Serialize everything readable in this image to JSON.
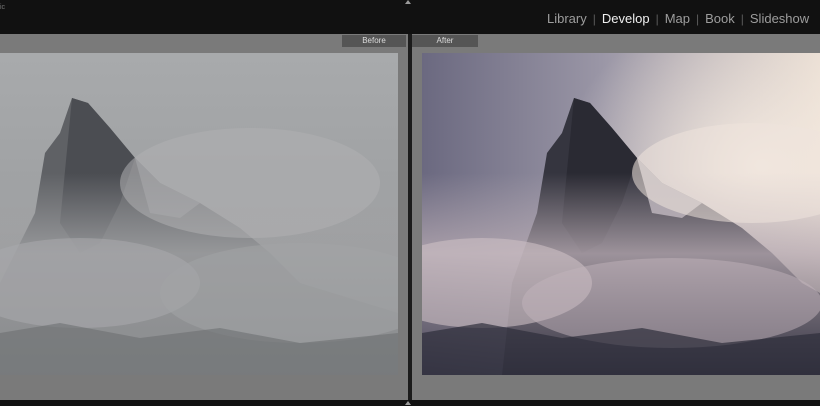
{
  "corner_text": "ic",
  "modules": {
    "items": [
      {
        "label": "Library",
        "active": false
      },
      {
        "label": "Develop",
        "active": true
      },
      {
        "label": "Map",
        "active": false
      },
      {
        "label": "Book",
        "active": false
      },
      {
        "label": "Slideshow",
        "active": false
      }
    ],
    "separator": "|"
  },
  "compare": {
    "before_label": "Before",
    "after_label": "After"
  },
  "colors": {
    "active_module": "#efefef",
    "inactive_module": "#9d9d9d",
    "workarea_bg": "#7a7a7a",
    "label_tag_bg": "#555555"
  }
}
